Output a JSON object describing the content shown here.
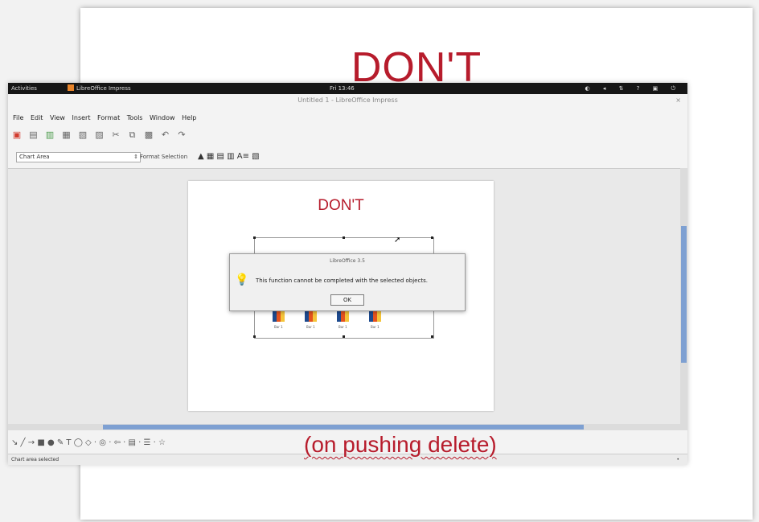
{
  "slide": {
    "title": "DON'T"
  },
  "caption": "(on pushing delete)",
  "topbar": {
    "activities": "Activities",
    "app_name": "LibreOffice Impress",
    "clock": "Fri 13:46",
    "tray": "◐ ◂ ⇅ ? ▣ ⏻"
  },
  "window": {
    "title": "Untitled 1 - LibreOffice Impress",
    "close": "×"
  },
  "menu": [
    "File",
    "Edit",
    "View",
    "Insert",
    "Format",
    "Tools",
    "Window",
    "Help"
  ],
  "toolbar": {
    "icons": [
      "new-icon",
      "open-icon",
      "save-icon",
      "export-icon",
      "print-icon",
      "pdf-icon",
      "cut-icon",
      "copy-icon",
      "paste-icon",
      "undo-icon",
      "redo-icon"
    ]
  },
  "chart_toolbar": {
    "selected_element": "Chart Area",
    "format_selection": "Format Selection",
    "icons": "▲ ▦ ▤ ▥ A≡ ▧"
  },
  "document": {
    "title": "DON'T"
  },
  "chart": {
    "label": "Bar 1"
  },
  "dialog": {
    "title": "LibreOffice 3.5",
    "message": "This function cannot be completed with the selected objects.",
    "ok": "OK"
  },
  "drawing_toolbar": {
    "tools": "↘ ╱ → ■ ● ✎ T ◯ ◇ · ◎ · ⇦ · ▤ · ☰ · ☆"
  },
  "status": {
    "left": "Chart area selected",
    "right": "•"
  },
  "colors": {
    "accent_red": "#b71c2c",
    "scroll_blue": "#7ea0d2"
  }
}
